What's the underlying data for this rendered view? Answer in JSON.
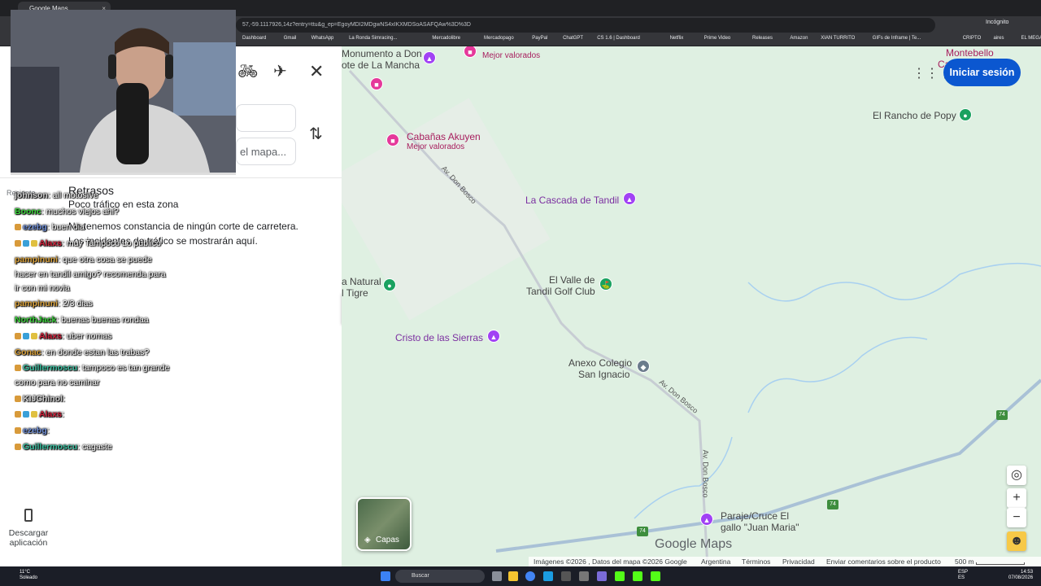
{
  "browser": {
    "tab_title": "Google Maps",
    "url": "57,-59.1117926,14z?entry=ttu&g_ep=EgoyMDI2MDgwNS4xIKXMDSoASAFQAw%3D%3D",
    "incognito": "Incógnito",
    "bookmarks": [
      "Dashboard",
      "Gmail",
      "WhatsApp",
      "La Ronda Simracing...",
      "Mercadolibre",
      "Mercadopago",
      "PayPal",
      "ChatGPT",
      "CS 1.6 | Dashboard",
      "Netflix",
      "Prime Video",
      "Releases",
      "Amazon",
      "XIAN TURRITO",
      "GIFs de Inframe | Te...",
      "CRIPTO",
      "aires",
      "EL MEGA PACK PAP..."
    ]
  },
  "panel": {
    "destination_placeholder": "el mapa...",
    "recent_label": "Reciente",
    "traffic": {
      "title": "Retrasos",
      "line1": "Poco tráfico en esta zona",
      "line2": "No tenemos constancia de ningún corte de carretera.",
      "line3": "Los incidentes de tráfico se mostrarán aquí."
    },
    "download_label_1": "Descargar",
    "download_label_2": "aplicación"
  },
  "chat": [
    {
      "user": "johnson",
      "color": "#cfcfcf",
      "text": ": all motosIve"
    },
    {
      "user": "Boonc",
      "color": "#3ad13a",
      "text": ": muchos viejos ahi?"
    },
    {
      "user": "ezebg",
      "color": "#6f8fd8",
      "text": ": buen dia"
    },
    {
      "user": "Alaxs",
      "color": "#d0213a",
      "text": ": muy Tampoco Lo publico"
    },
    {
      "user": "pampinuni",
      "color": "#d9a13a",
      "text": ": que otra cosa se puede"
    },
    {
      "user": "",
      "color": "#ffffff",
      "text": "hacer en tandil amigo? recomenda para"
    },
    {
      "user": "",
      "color": "#ffffff",
      "text": "ir con mi novia"
    },
    {
      "user": "pampinuni",
      "color": "#d9a13a",
      "text": ": 2/3 dias"
    },
    {
      "user": "NorthJack",
      "color": "#3ad13a",
      "text": ": buenas buenas rondaa"
    },
    {
      "user": "Alaxs",
      "color": "#d0213a",
      "text": ": uber nomas"
    },
    {
      "user": "Gonac",
      "color": "#d9a13a",
      "text": ": en donde estan las trabas?"
    },
    {
      "user": "Guillermoscu",
      "color": "#3ac0a0",
      "text": ": tampoco es tan grande"
    },
    {
      "user": "",
      "color": "#ffffff",
      "text": "como para no caminar"
    },
    {
      "user": "KIJChinol",
      "color": "#cfcfcf",
      "text": ":"
    },
    {
      "user": "Alaxs",
      "color": "#d0213a",
      "text": ":"
    },
    {
      "user": "ezebg",
      "color": "#6f8fd8",
      "text": ":"
    },
    {
      "user": "Guillermoscu",
      "color": "#3ac0a0",
      "text": ": cagaste"
    }
  ],
  "map": {
    "places": {
      "monumento_1": "Monumento a Don",
      "monumento_2": "ote de La Mancha",
      "mejor_valorados_top": "Mejor valorados",
      "cabanas": "Cabañas Akuyen",
      "cabanas_sub": "Mejor valorados",
      "cascada": "La Cascada de Tandil",
      "rancho": "El Rancho de Popy",
      "montebello_1": "Montebello",
      "montebello_2": "Cabañ",
      "valle_1": "El Valle de",
      "valle_2": "Tandil Golf Club",
      "natural_1": "a Natural",
      "natural_2": "l Tigre",
      "cristo": "Cristo de las Sierras",
      "anexo_1": "Anexo Colegio",
      "anexo_2": "San Ignacio",
      "paraje_1": "Paraje/Cruce El",
      "paraje_2": "gallo \"Juan Maria\""
    },
    "road_label": "Av. Don Bosco",
    "route_number": "74",
    "signin": "Iniciar sesión",
    "layers": "Capas",
    "logo": "Google Maps",
    "footer": {
      "imagery": "Imágenes ©2026 , Datos del mapa ©2026 Google",
      "country": "Argentina",
      "terms": "Términos",
      "privacy": "Privacidad",
      "feedback": "Enviar comentarios sobre el producto",
      "scale": "500 m"
    }
  },
  "taskbar": {
    "temp": "11°C",
    "weather": "Soleado",
    "search": "Buscar",
    "lang1": "ESP",
    "lang2": "ES",
    "time": "14:53",
    "date": "07/08/2026"
  }
}
